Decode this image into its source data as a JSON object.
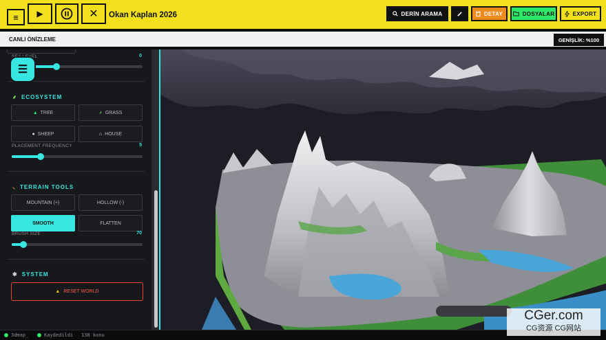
{
  "topbar": {
    "menu_icon": "≡",
    "play_icon": "▶",
    "pause_icon": "⏸",
    "close_icon": "✕",
    "title": "Okan Kaplan 2026",
    "search_label": "DERİN ARAMA",
    "detail_label": "DETAY",
    "files_label": "DOSYALAR",
    "export_label": "EXPORT"
  },
  "preview": {
    "title": "CANLI ÖNİZLEME",
    "width_badge": "GENİŞLİK: %100"
  },
  "sidebar": {
    "sea_level": {
      "label": "SEA LEVEL",
      "value": "0",
      "fraction": 0.34
    },
    "ecosystem": {
      "title": "ECOSYSTEM",
      "buttons": [
        "TREE",
        "GRASS",
        "SHEEP",
        "HOUSE"
      ],
      "placement_frequency": {
        "label": "PLACEMENT FREQUENCY",
        "value": "5",
        "fraction": 0.22
      }
    },
    "terrain_tools": {
      "title": "TERRAIN TOOLS",
      "buttons": [
        "MOUNTAIN (+)",
        "HOLLOW (-)",
        "SMOOTH",
        "FLATTEN"
      ],
      "active": "SMOOTH",
      "brush_size": {
        "label": "BRUSH SIZE",
        "value": "70",
        "fraction": 0.09
      }
    },
    "system": {
      "title": "SYSTEM",
      "reset_label": "RESET WORLD"
    }
  },
  "footer": {
    "file": "3dmap_",
    "status": "Kaydedildi",
    "word_count": "138 konu"
  },
  "watermark": {
    "main": "CGer.com",
    "sub": "CG资源 CG网站"
  },
  "colors": {
    "accent_cyan": "#37e6e0",
    "topbar_yellow": "#f2e01d",
    "detail_orange": "#f08a1c",
    "files_green": "#2ee86a",
    "reset_red": "#e8473c"
  }
}
